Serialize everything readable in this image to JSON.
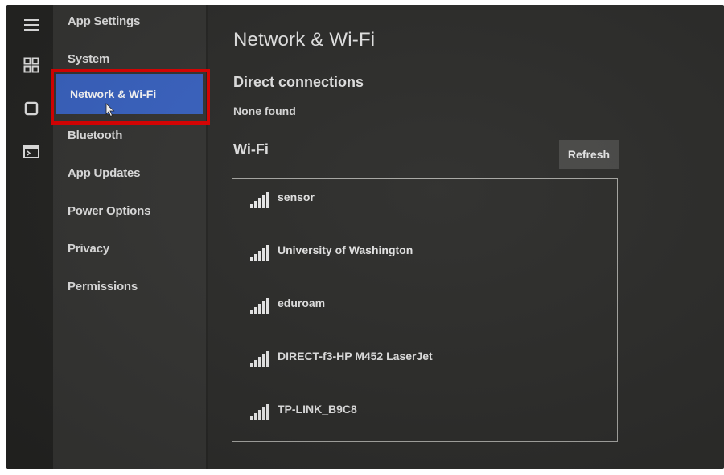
{
  "rail": {
    "icons": [
      "hamburger-menu-icon",
      "apps-grid-icon",
      "processor-chip-icon",
      "terminal-icon"
    ]
  },
  "nav": {
    "heading": "App Settings",
    "items": [
      {
        "label": "System"
      },
      {
        "label": "Network & Wi-Fi",
        "selected": true
      },
      {
        "label": "Bluetooth"
      },
      {
        "label": "App Updates"
      },
      {
        "label": "Power Options"
      },
      {
        "label": "Privacy"
      },
      {
        "label": "Permissions"
      }
    ]
  },
  "main": {
    "title": "Network & Wi-Fi",
    "direct": {
      "heading": "Direct connections",
      "status": "None found"
    },
    "wifi": {
      "heading": "Wi-Fi",
      "refresh_label": "Refresh",
      "networks": [
        {
          "name": "sensor"
        },
        {
          "name": "University of Washington"
        },
        {
          "name": "eduroam"
        },
        {
          "name": "DIRECT-f3-HP M452 LaserJet"
        },
        {
          "name": "TP-LINK_B9C8"
        }
      ]
    }
  },
  "colors": {
    "accent": "#3a64c4",
    "annotation": "#e00000"
  }
}
